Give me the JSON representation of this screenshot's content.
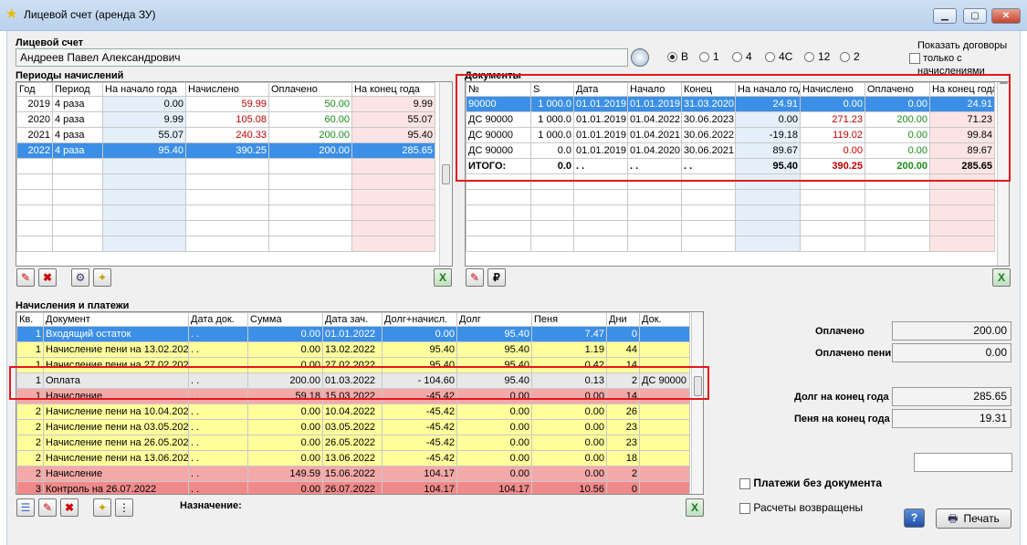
{
  "window": {
    "title": "Лицевой счет (аренда ЗУ)"
  },
  "account": {
    "label": "Лицевой счет",
    "name": "Андреев Павел Александрович"
  },
  "period_radios": {
    "options": [
      "В",
      "1",
      "4",
      "4С",
      "12",
      "2"
    ],
    "selected": "В"
  },
  "contracts_toggle": {
    "label1": "Показать договоры",
    "label2": "только с",
    "label3": "начислениями"
  },
  "periods": {
    "title": "Периоды начислений",
    "headers": [
      "Год",
      "Период",
      "На начало года",
      "Начислено",
      "Оплачено",
      "На конец года"
    ],
    "rows": [
      [
        "2019",
        "4 раза",
        "0.00",
        "59.99",
        "50.00",
        "9.99"
      ],
      [
        "2020",
        "4 раза",
        "9.99",
        "105.08",
        "60.00",
        "55.07"
      ],
      [
        "2021",
        "4 раза",
        "55.07",
        "240.33",
        "200.00",
        "95.40"
      ],
      [
        "2022",
        "4 раза",
        "95.40",
        "390.25",
        "200.00",
        "285.65"
      ]
    ],
    "selected_row": 3
  },
  "documents": {
    "title": "Документы",
    "headers": [
      "№",
      "S",
      "Дата",
      "Начало",
      "Конец",
      "На начало год",
      "Начислено",
      "Оплачено",
      "На конец года"
    ],
    "rows": [
      [
        "90000",
        "1 000.0",
        "01.01.2019",
        "01.01.2019",
        "31.03.2020",
        "24.91",
        "0.00",
        "0.00",
        "24.91"
      ],
      [
        "ДС 90000",
        "1 000.0",
        "01.01.2019",
        "01.04.2022",
        "30.06.2023",
        "0.00",
        "271.23",
        "200.00",
        "71.23"
      ],
      [
        "ДС 90000",
        "1 000.0",
        "01.01.2019",
        "01.04.2021",
        "30.06.2022",
        "-19.18",
        "119.02",
        "0.00",
        "99.84"
      ],
      [
        "ДС 90000",
        "0.0",
        "01.01.2019",
        "01.04.2020",
        "30.06.2021",
        "89.67",
        "0.00",
        "0.00",
        "89.67"
      ]
    ],
    "total": [
      "ИТОГО:",
      "0.0",
      ". .",
      ". .",
      ". .",
      "95.40",
      "390.25",
      "200.00",
      "285.65"
    ]
  },
  "payments": {
    "title": "Начисления и платежи",
    "headers": [
      "Кв.",
      "Документ",
      "Дата док.",
      "Сумма",
      "Дата зач.",
      "Долг+начисл.",
      "Долг",
      "Пеня",
      "Дни",
      "Док."
    ],
    "rows": [
      {
        "c": [
          "1",
          "Входящий остаток",
          ". .",
          "0.00",
          "01.01.2022",
          "0.00",
          "95.40",
          "7.47",
          "0",
          ""
        ],
        "style": "bl"
      },
      {
        "c": [
          "1",
          "Начисление пени на 13.02.2022",
          ". .",
          "0.00",
          "13.02.2022",
          "95.40",
          "95.40",
          "1.19",
          "44",
          ""
        ],
        "style": "ylw"
      },
      {
        "c": [
          "1",
          "Начисление пени на 27.02.2022",
          ". .",
          "0.00",
          "27.02.2022",
          "95.40",
          "95.40",
          "0.42",
          "14",
          ""
        ],
        "style": "ylw"
      },
      {
        "c": [
          "1",
          "Оплата",
          ". .",
          "200.00",
          "01.03.2022",
          "- 104.60",
          "95.40",
          "0.13",
          "2",
          "ДС 90000"
        ],
        "style": "gry"
      },
      {
        "c": [
          "1",
          "Начисление",
          ". .",
          "59.18",
          "15.03.2022",
          "-45.42",
          "0.00",
          "0.00",
          "14",
          ""
        ],
        "style": "pnk"
      },
      {
        "c": [
          "2",
          "Начисление пени на 10.04.2022",
          ". .",
          "0.00",
          "10.04.2022",
          "-45.42",
          "0.00",
          "0.00",
          "26",
          ""
        ],
        "style": "ylw"
      },
      {
        "c": [
          "2",
          "Начисление пени на 03.05.2022",
          ". .",
          "0.00",
          "03.05.2022",
          "-45.42",
          "0.00",
          "0.00",
          "23",
          ""
        ],
        "style": "ylw"
      },
      {
        "c": [
          "2",
          "Начисление пени на 26.05.2022",
          ". .",
          "0.00",
          "26.05.2022",
          "-45.42",
          "0.00",
          "0.00",
          "23",
          ""
        ],
        "style": "ylw"
      },
      {
        "c": [
          "2",
          "Начисление пени на 13.06.2022",
          ". .",
          "0.00",
          "13.06.2022",
          "-45.42",
          "0.00",
          "0.00",
          "18",
          ""
        ],
        "style": "ylw"
      },
      {
        "c": [
          "2",
          "Начисление",
          ". .",
          "149.59",
          "15.06.2022",
          "104.17",
          "0.00",
          "0.00",
          "2",
          ""
        ],
        "style": "pnk"
      },
      {
        "c": [
          "3",
          "Контроль на 26.07.2022",
          ". .",
          "0.00",
          "26.07.2022",
          "104.17",
          "104.17",
          "10.56",
          "0",
          ""
        ],
        "style": "pnkd"
      }
    ],
    "purpose_label": "Назначение:"
  },
  "summary": {
    "paid_label": "Оплачено",
    "paid": "200.00",
    "paid_penalty_label": "Оплачено пени",
    "paid_penalty": "0.00",
    "debt_label": "Долг на конец года",
    "debt": "285.65",
    "penalty_label": "Пеня на конец года",
    "penalty": "19.31"
  },
  "checkboxes": {
    "no_doc": "Платежи без документа",
    "refunded": "Расчеты возвращены"
  },
  "print_label": "Печать",
  "colors": {
    "selected": "#3b8fe6",
    "yellow_row": "#ffff9b",
    "pink_row": "#f4a9a9",
    "red_text": "#c00000",
    "green_text": "#1a8a1a",
    "highlight_box": "#e0191c"
  }
}
